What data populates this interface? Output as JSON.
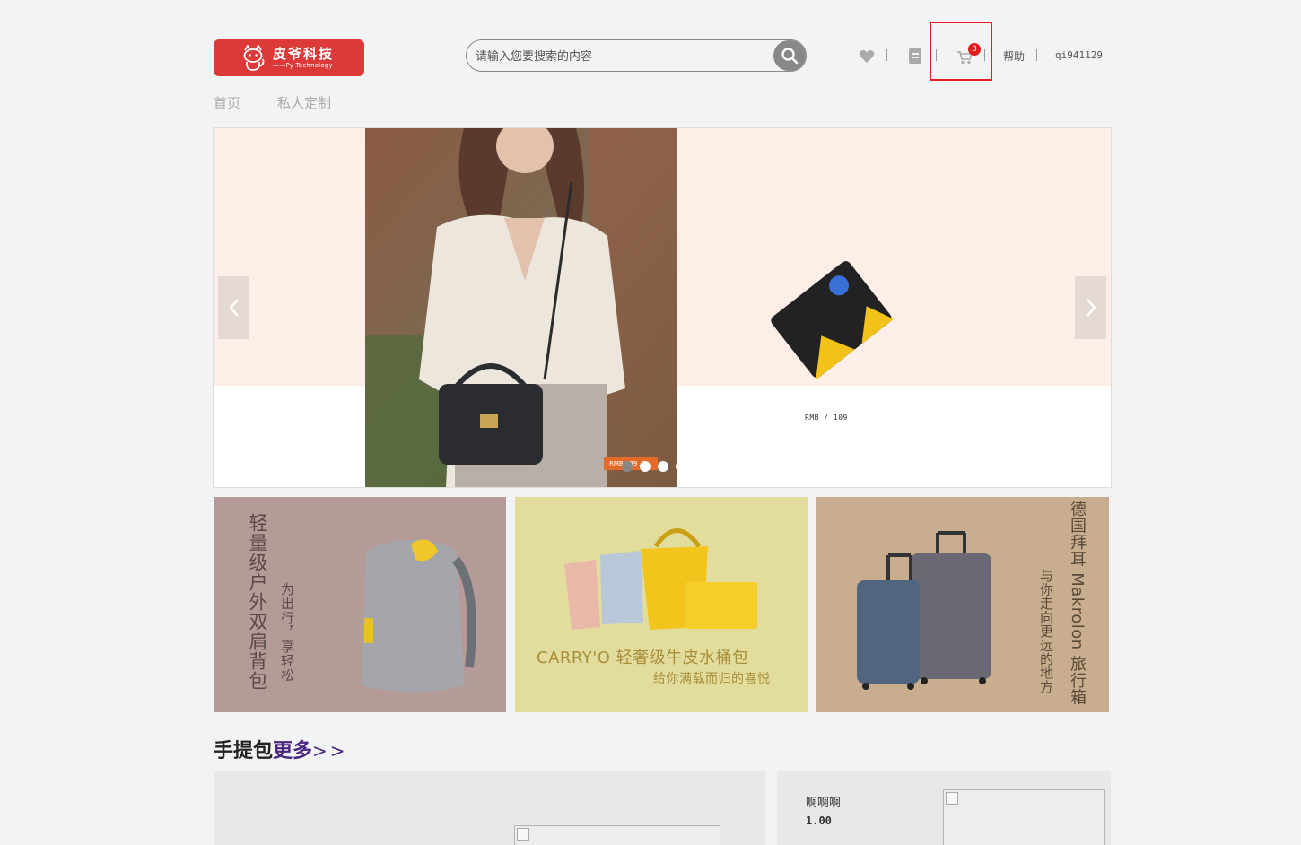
{
  "brand": {
    "name": "皮爷科技",
    "tagline": "——Py Technology",
    "color": "#dc3a38"
  },
  "search": {
    "placeholder": "请输入您要搜索的内容",
    "value": ""
  },
  "header": {
    "icons": [
      "heart-icon",
      "orders-icon",
      "cart-icon"
    ],
    "cart_count": "3",
    "help_label": "帮助",
    "username": "qi941129"
  },
  "nav": {
    "items": [
      "首页",
      "私人定制"
    ]
  },
  "carousel": {
    "price_text": "RMB / 109",
    "tag_text": "RMB 139",
    "slide_count": 4,
    "active_index": 0
  },
  "promos": [
    {
      "title": "轻量级户外双肩背包",
      "subtitle": "为出行，享轻松",
      "bg": "#b59b97"
    },
    {
      "title": "CARRY'O 轻奢级牛皮水桶包",
      "subtitle": "给你满载而归的喜悦",
      "bg": "#e2dc9d"
    },
    {
      "title": "德国拜耳 Makrolon 旅行箱",
      "subtitle": "与你走向更远的地方",
      "bg": "#c8ae8f"
    }
  ],
  "section": {
    "title": "手提包",
    "more_label": "更多",
    "more_arrows": ">>"
  },
  "products": [
    {
      "name": "啊啊啊",
      "price": "1.00"
    }
  ],
  "accent": "#e02020"
}
